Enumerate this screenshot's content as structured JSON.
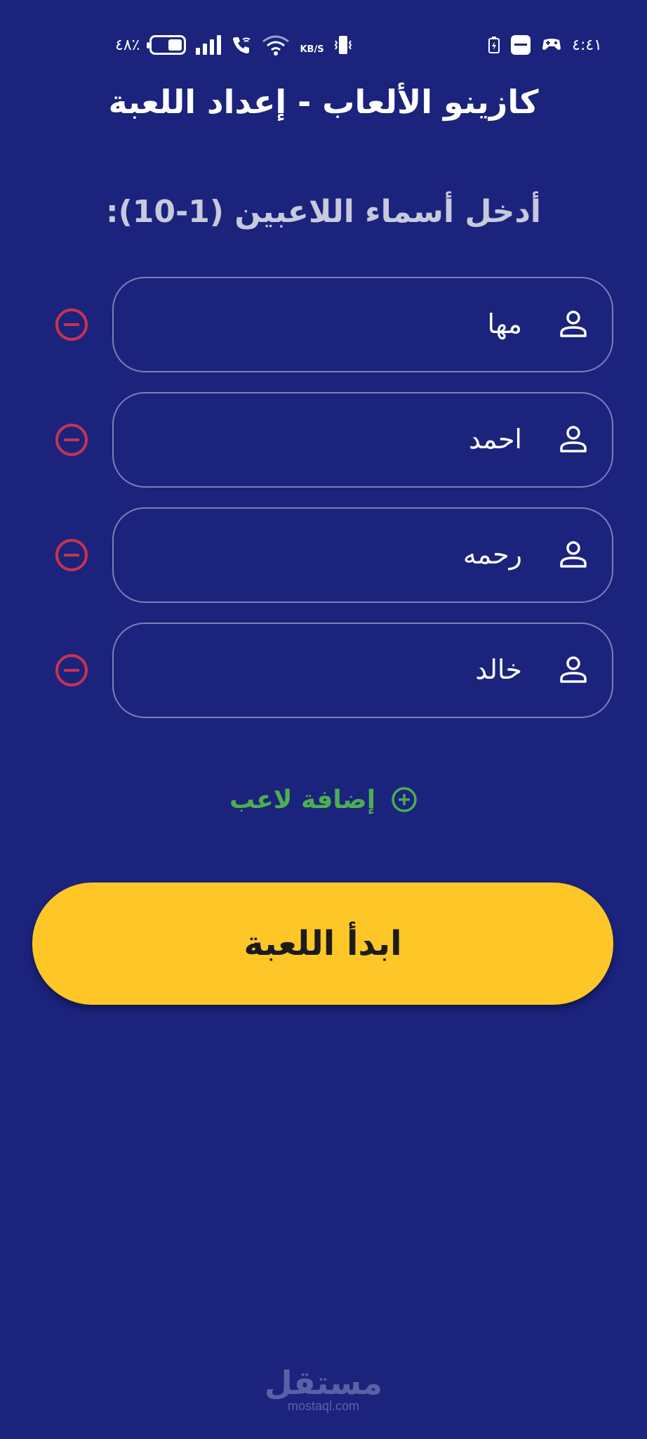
{
  "status_bar": {
    "time": "٤:٤١",
    "battery": "٤٨٪",
    "battery_level": 0.48,
    "net_speed_unit_top": "KB/S",
    "icons_left": [
      "battery-icon",
      "signal-icon",
      "wifi-call-icon",
      "wifi-icon",
      "net-speed",
      "vibrate-icon"
    ],
    "icons_right": [
      "battery-saver-icon",
      "notification-icon",
      "game-icon"
    ]
  },
  "header": {
    "title": "كازينو الألعاب - إعداد اللعبة"
  },
  "form": {
    "prompt": "أدخل أسماء اللاعبين (1-10):",
    "players": [
      {
        "name": "مها"
      },
      {
        "name": "احمد"
      },
      {
        "name": "رحمه"
      },
      {
        "name": "خالد"
      }
    ],
    "add_player_label": "إضافة لاعب",
    "start_label": "ابدأ اللعبة"
  },
  "colors": {
    "background": "#1b237d",
    "field_border": "#7a80b8",
    "remove": "#c8334f",
    "add": "#4caf50",
    "start_button": "#fec727"
  },
  "watermark": {
    "arabic": "مستقل",
    "latin": "mostaql.com"
  }
}
